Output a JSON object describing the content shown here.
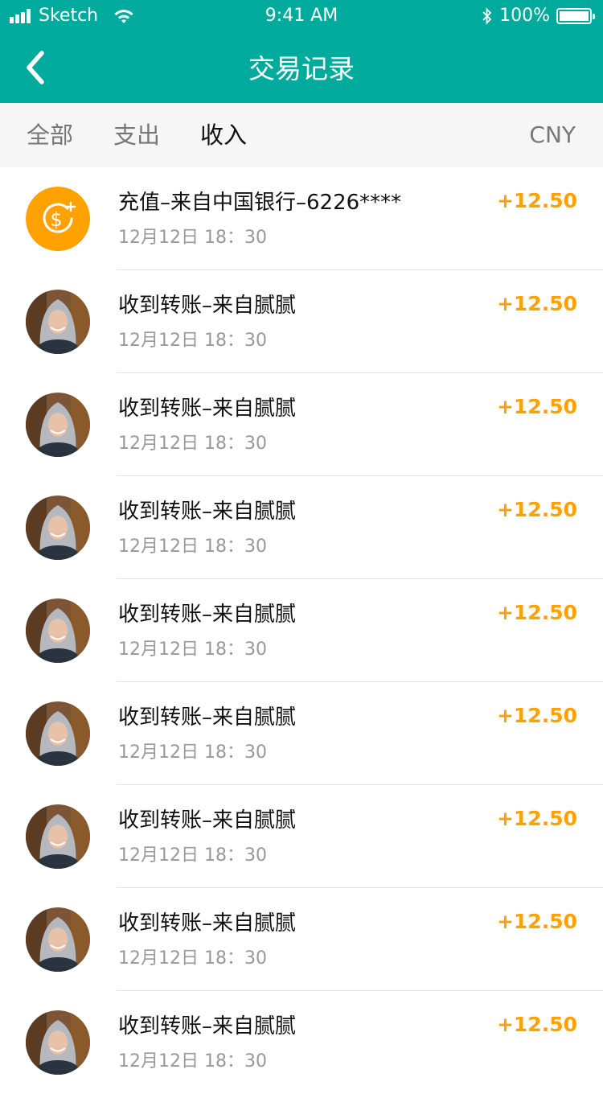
{
  "status_bar": {
    "carrier": "Sketch",
    "time": "9:41 AM",
    "battery": "100%"
  },
  "nav": {
    "title": "交易记录",
    "back_icon": "chevron-left-icon"
  },
  "tabs": {
    "items": [
      {
        "label": "全部",
        "active": false
      },
      {
        "label": "支出",
        "active": false
      },
      {
        "label": "收入",
        "active": true
      }
    ],
    "currency": "CNY"
  },
  "colors": {
    "brand": "#00ab9e",
    "amount": "#ffa200",
    "coin": "#ffa200"
  },
  "transactions": [
    {
      "icon": "coin-dollar-icon",
      "title": "充值–来自中国银行–6226****",
      "time": "12月12日 18：30",
      "amount": "+12.50"
    },
    {
      "icon": "avatar",
      "title": "收到转账–来自腻腻",
      "time": "12月12日 18：30",
      "amount": "+12.50"
    },
    {
      "icon": "avatar",
      "title": "收到转账–来自腻腻",
      "time": "12月12日 18：30",
      "amount": "+12.50"
    },
    {
      "icon": "avatar",
      "title": "收到转账–来自腻腻",
      "time": "12月12日 18：30",
      "amount": "+12.50"
    },
    {
      "icon": "avatar",
      "title": "收到转账–来自腻腻",
      "time": "12月12日 18：30",
      "amount": "+12.50"
    },
    {
      "icon": "avatar",
      "title": "收到转账–来自腻腻",
      "time": "12月12日 18：30",
      "amount": "+12.50"
    },
    {
      "icon": "avatar",
      "title": "收到转账–来自腻腻",
      "time": "12月12日 18：30",
      "amount": "+12.50"
    },
    {
      "icon": "avatar",
      "title": "收到转账–来自腻腻",
      "time": "12月12日 18：30",
      "amount": "+12.50"
    },
    {
      "icon": "avatar",
      "title": "收到转账–来自腻腻",
      "time": "12月12日 18：30",
      "amount": "+12.50"
    }
  ]
}
